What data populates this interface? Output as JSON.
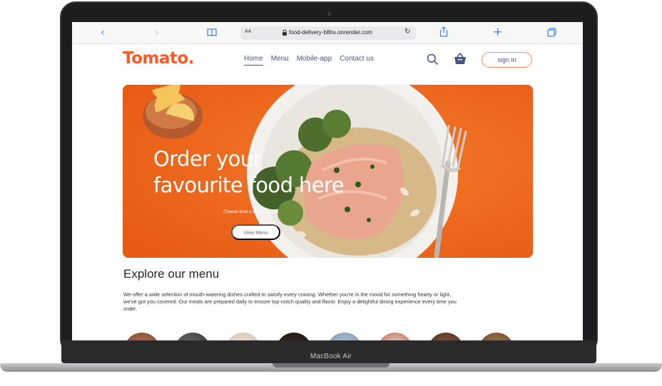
{
  "browser": {
    "aa_label": "AA",
    "url": "food-delivery-b8hs.onrender.com",
    "icons": [
      "back-icon",
      "forward-icon",
      "book-icon",
      "lock-icon",
      "reload-icon",
      "share-icon",
      "new-tab-icon",
      "tabs-icon"
    ]
  },
  "site": {
    "logo": "Tomato.",
    "nav": [
      {
        "label": "Home",
        "active": true
      },
      {
        "label": "Menu",
        "active": false
      },
      {
        "label": "Mobile-app",
        "active": false
      },
      {
        "label": "Contact us",
        "active": false
      }
    ],
    "signin_label": "sign in",
    "accent": "#ff5a26"
  },
  "hero": {
    "title_line1": "Order your",
    "title_line2": "favourite food here",
    "subtitle": "Choose from a diverse menu",
    "button_label": "View Menu",
    "background": "#f16a1e"
  },
  "explore": {
    "heading": "Explore our menu",
    "description": "We offer a wide selection of mouth-watering dishes crafted to satisfy every craving. Whether you're in the mood for something hearty or light, we've got you covered. Our meals are prepared daily to ensure top-notch quality and flavor. Enjoy a delightful dining experience every time you order."
  },
  "device": {
    "label": "MacBook Air"
  }
}
